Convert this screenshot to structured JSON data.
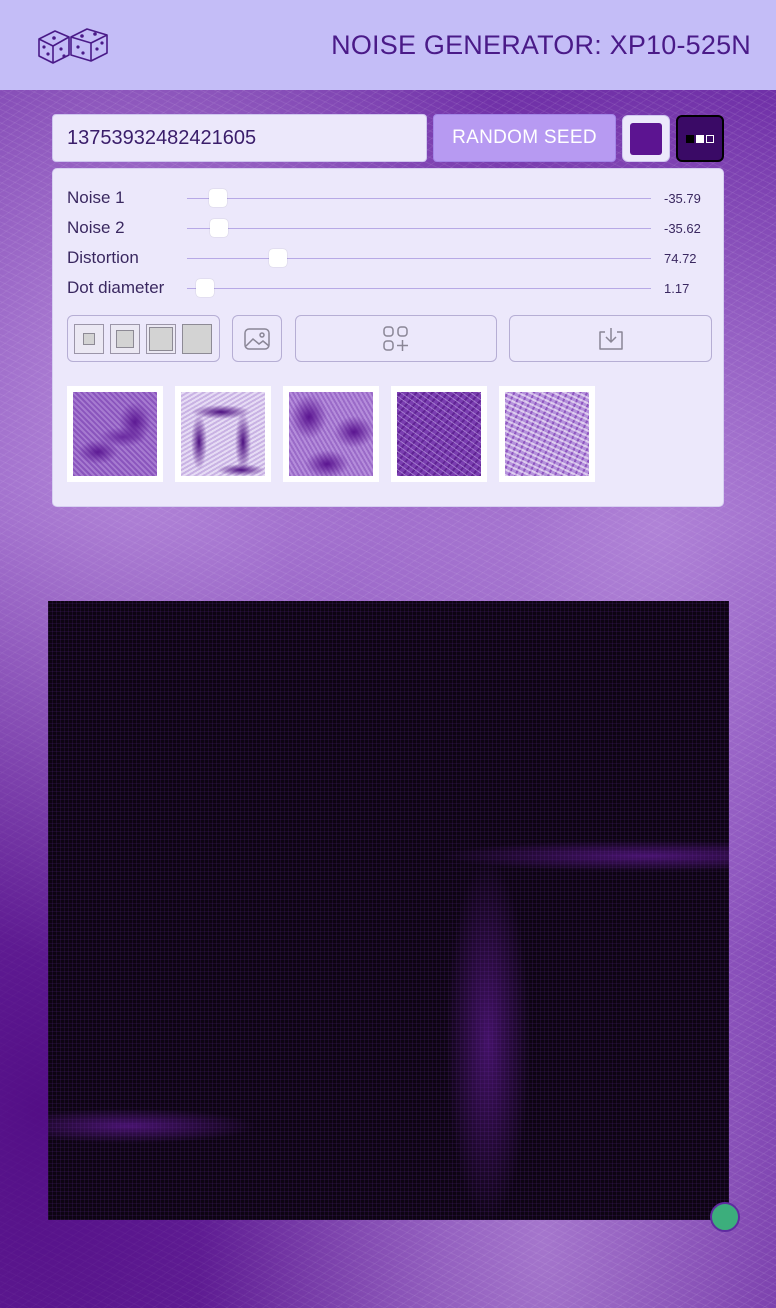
{
  "header": {
    "logo_icon": "dice-icon",
    "title": "NOISE GENERATOR: XP10-525N"
  },
  "seed": {
    "value": "13753932482421605"
  },
  "toolbar": {
    "random_seed_label": "RANDOM SEED",
    "color": "#5c1491",
    "mode_icon": "render-mode-icon"
  },
  "sliders": [
    {
      "label": "Noise 1",
      "value": "-35.79"
    },
    {
      "label": "Noise 2",
      "value": "-35.62"
    },
    {
      "label": "Distortion",
      "value": "74.72"
    },
    {
      "label": "Dot diameter",
      "value": "1.17"
    }
  ],
  "tools": {
    "size_options": [
      "size-xs",
      "size-s",
      "size-m",
      "size-l"
    ],
    "image_icon": "image-icon",
    "add_preset_icon": "add-grid-icon",
    "download_icon": "download-icon"
  },
  "presets": [
    "preset-1",
    "preset-2",
    "preset-3",
    "preset-4",
    "preset-5"
  ],
  "colors": {
    "header_bg": "#c4bdf7",
    "accent": "#b79af2",
    "panel_bg": "#ece8fb",
    "title_text": "#4a1a88",
    "status_dot": "#3cae7c"
  }
}
